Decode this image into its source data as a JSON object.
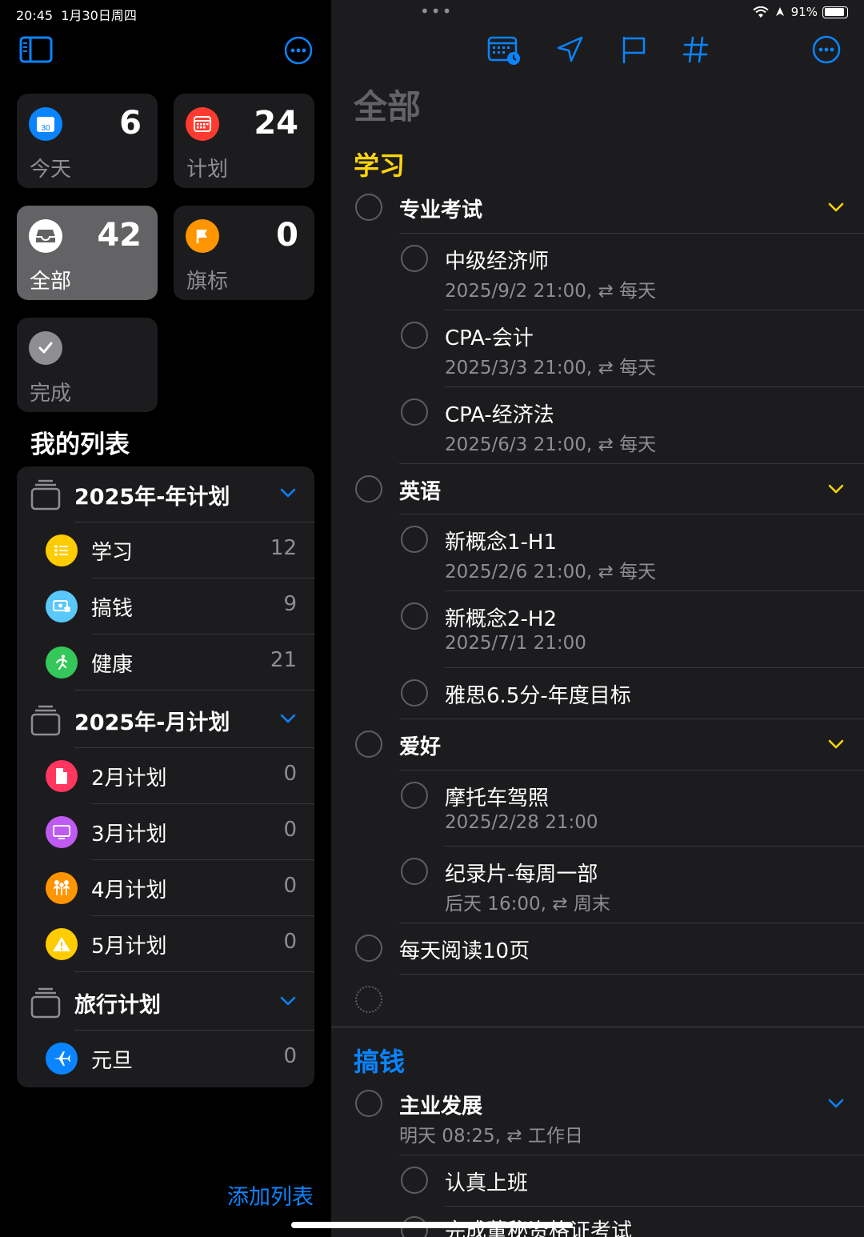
{
  "status": {
    "time": "20:45",
    "date": "1月30日周四",
    "battery": "91%"
  },
  "sidebar": {
    "cards": {
      "today": {
        "label": "今天",
        "count": "6",
        "icon": "calendar-30-icon",
        "color": "#0a84ff",
        "day": "30"
      },
      "scheduled": {
        "label": "计划",
        "count": "24",
        "icon": "calendar-grid-icon",
        "color": "#ff3b30"
      },
      "all": {
        "label": "全部",
        "count": "42",
        "icon": "tray-icon",
        "color": "#ffffff"
      },
      "flagged": {
        "label": "旗标",
        "count": "0",
        "icon": "flag-icon",
        "color": "#ff9500"
      },
      "completed": {
        "label": "完成",
        "icon": "checkmark-icon",
        "color": "#8e8e93"
      }
    },
    "my_lists_title": "我的列表",
    "groups": [
      {
        "label": "2025年-年计划",
        "items": [
          {
            "label": "学习",
            "count": "12",
            "icon": "list-icon",
            "color": "#ffcc00"
          },
          {
            "label": "搞钱",
            "count": "9",
            "icon": "money-icon",
            "color": "#5ac8fa"
          },
          {
            "label": "健康",
            "count": "21",
            "icon": "running-icon",
            "color": "#34c759"
          }
        ]
      },
      {
        "label": "2025年-月计划",
        "items": [
          {
            "label": "2月计划",
            "count": "0",
            "icon": "document-icon",
            "color": "#ff375f"
          },
          {
            "label": "3月计划",
            "count": "0",
            "icon": "display-icon",
            "color": "#bf5af2"
          },
          {
            "label": "4月计划",
            "count": "0",
            "icon": "people-icon",
            "color": "#ff9500"
          },
          {
            "label": "5月计划",
            "count": "0",
            "icon": "warning-icon",
            "color": "#ffcc00"
          }
        ]
      },
      {
        "label": "旅行计划",
        "items": [
          {
            "label": "元旦",
            "count": "0",
            "icon": "airplane-icon",
            "color": "#0a84ff"
          }
        ]
      }
    ],
    "add_list": "添加列表"
  },
  "main": {
    "title": "全部",
    "sections": [
      {
        "title": "学习",
        "tasks": [
          {
            "title": "专业考试",
            "group": true,
            "children": [
              {
                "title": "中级经济师",
                "date": "2025/9/2 21:00,",
                "repeat": "每天"
              },
              {
                "title": "CPA-会计",
                "date": "2025/3/3 21:00,",
                "repeat": "每天"
              },
              {
                "title": "CPA-经济法",
                "date": "2025/6/3 21:00,",
                "repeat": "每天"
              }
            ]
          },
          {
            "title": "英语",
            "group": true,
            "children": [
              {
                "title": "新概念1-H1",
                "date": "2025/2/6 21:00,",
                "repeat": "每天"
              },
              {
                "title": "新概念2-H2",
                "date": "2025/7/1 21:00"
              },
              {
                "title": "雅思6.5分-年度目标"
              }
            ]
          },
          {
            "title": "爱好",
            "group": true,
            "children": [
              {
                "title": "摩托车驾照",
                "date": "2025/2/28 21:00"
              },
              {
                "title": "纪录片-每周一部",
                "date": "后天 16:00,",
                "repeat": "周末"
              }
            ]
          },
          {
            "title": "每天阅读10页"
          }
        ]
      },
      {
        "title": "搞钱",
        "tasks": [
          {
            "title": "主业发展",
            "group": true,
            "date": "明天 08:25,",
            "repeat": "工作日",
            "children": [
              {
                "title": "认真上班"
              },
              {
                "title": "完成董秘资格证考试"
              }
            ]
          }
        ]
      }
    ]
  },
  "colors": {
    "accent": "#0a84ff",
    "section": "#ffd60a"
  }
}
